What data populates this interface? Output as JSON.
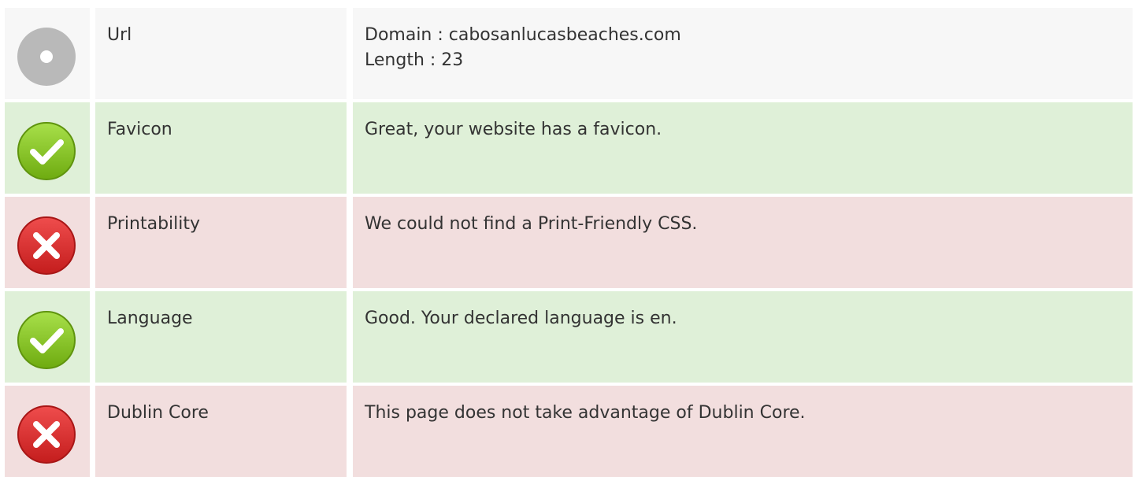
{
  "colors": {
    "neutral_row_bg": "#f7f7f7",
    "pass_row_bg": "#dff0d8",
    "fail_row_bg": "#f2dede",
    "pass_icon": "#8ccf1f",
    "fail_icon": "#d92b2b",
    "neutral_icon": "#b9b9b9",
    "text": "#333333"
  },
  "rows": [
    {
      "status": "neutral",
      "icon": "neutral-dot-icon",
      "label": "Url",
      "details": [
        "Domain : cabosanlucasbeaches.com",
        "Length : 23"
      ]
    },
    {
      "status": "pass",
      "icon": "check-icon",
      "label": "Favicon",
      "details": [
        "Great, your website has a favicon."
      ]
    },
    {
      "status": "fail",
      "icon": "cross-icon",
      "label": "Printability",
      "details": [
        "We could not find a Print-Friendly CSS."
      ]
    },
    {
      "status": "pass",
      "icon": "check-icon",
      "label": "Language",
      "details": [
        "Good. Your declared language is en."
      ]
    },
    {
      "status": "fail",
      "icon": "cross-icon",
      "label": "Dublin Core",
      "details": [
        "This page does not take advantage of Dublin Core."
      ]
    }
  ]
}
